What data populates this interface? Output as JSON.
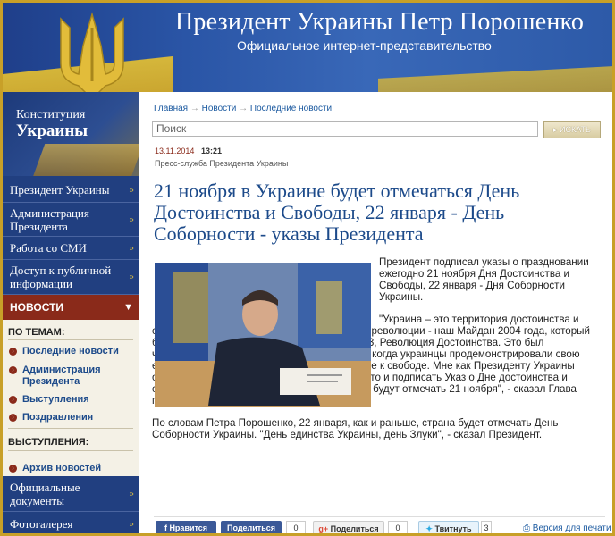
{
  "header": {
    "title": "Президент Украины Петр Порошенко",
    "subtitle": "Официальное интернет-представительство"
  },
  "sidebar": {
    "constitution": {
      "line1": "Конституция",
      "line2": "Украины"
    },
    "items": [
      {
        "label": "Президент Украины"
      },
      {
        "label": "Администрация Президента"
      },
      {
        "label": "Работа со СМИ"
      },
      {
        "label": "Доступ к публичной информации"
      }
    ],
    "news_label": "НОВОСТИ",
    "topics_heading": "ПО ТЕМАМ:",
    "topics": [
      "Последние новости",
      "Администрация Президента",
      "Выступления",
      "Поздравления"
    ],
    "speeches_heading": "ВЫСТУПЛЕНИЯ:",
    "archive": "Архив новостей",
    "bottom_items": [
      {
        "label": "Официальные документы"
      },
      {
        "label": "Фотогалерея"
      }
    ]
  },
  "breadcrumb": {
    "items": [
      "Главная",
      "Новости",
      "Последние новости"
    ]
  },
  "search": {
    "placeholder": "Поиск",
    "button": "ИСКАТЬ"
  },
  "article": {
    "date": "13.11.2014",
    "time": "13:21",
    "source": "Пресс-служба Президента Украины",
    "title": "21 ноября в Украине будет отмечаться День Достоинства и Свободы, 22 января - День Соборности - указы Президента",
    "para1": "Президент подписал указы о праздновании ежегодно 21 ноября Дня Достоинства и Свободы, 22 января - Дня Соборности Украины.",
    "para2": "\"Украина – это территория достоинства и свободы. Такими нас сделала не одна, а две революции - наш Майдан 2004 года, который был Праздником Свободы, и Революция 2013, Революция Достоинства. Это был чрезвычайно тяжелый экзамен для Украины, когда украинцы продемонстрировали свою европейскость, достоинство, свое стремление к свободе. Мне как Президенту Украины остается лишь документально подтвердить это и подписать Указ о Дне достоинства и свободы, который украинцы отныне и навеки будут отмечать 21 ноября\", - сказал Глава государства.",
    "para3": "По словам Петра Порошенко, 22 января, как и раньше, страна будет отмечать День Соборности Украины. \"День единства Украины, день Злуки\", - сказал Президент."
  },
  "share": {
    "fb_like": "Нравится",
    "fb_share": "Поделиться",
    "fb_count": "0",
    "gplus": "Поделиться",
    "gplus_count": "0",
    "twitter": "Твитнуть",
    "twitter_count": "3",
    "print": "Версия для печати"
  },
  "colors": {
    "header_blue": "#2a55a6",
    "sidebar_blue": "#213f80",
    "news_red": "#8a2a1a",
    "link_blue": "#1c4a8a",
    "frame_gold": "#c8a028"
  }
}
